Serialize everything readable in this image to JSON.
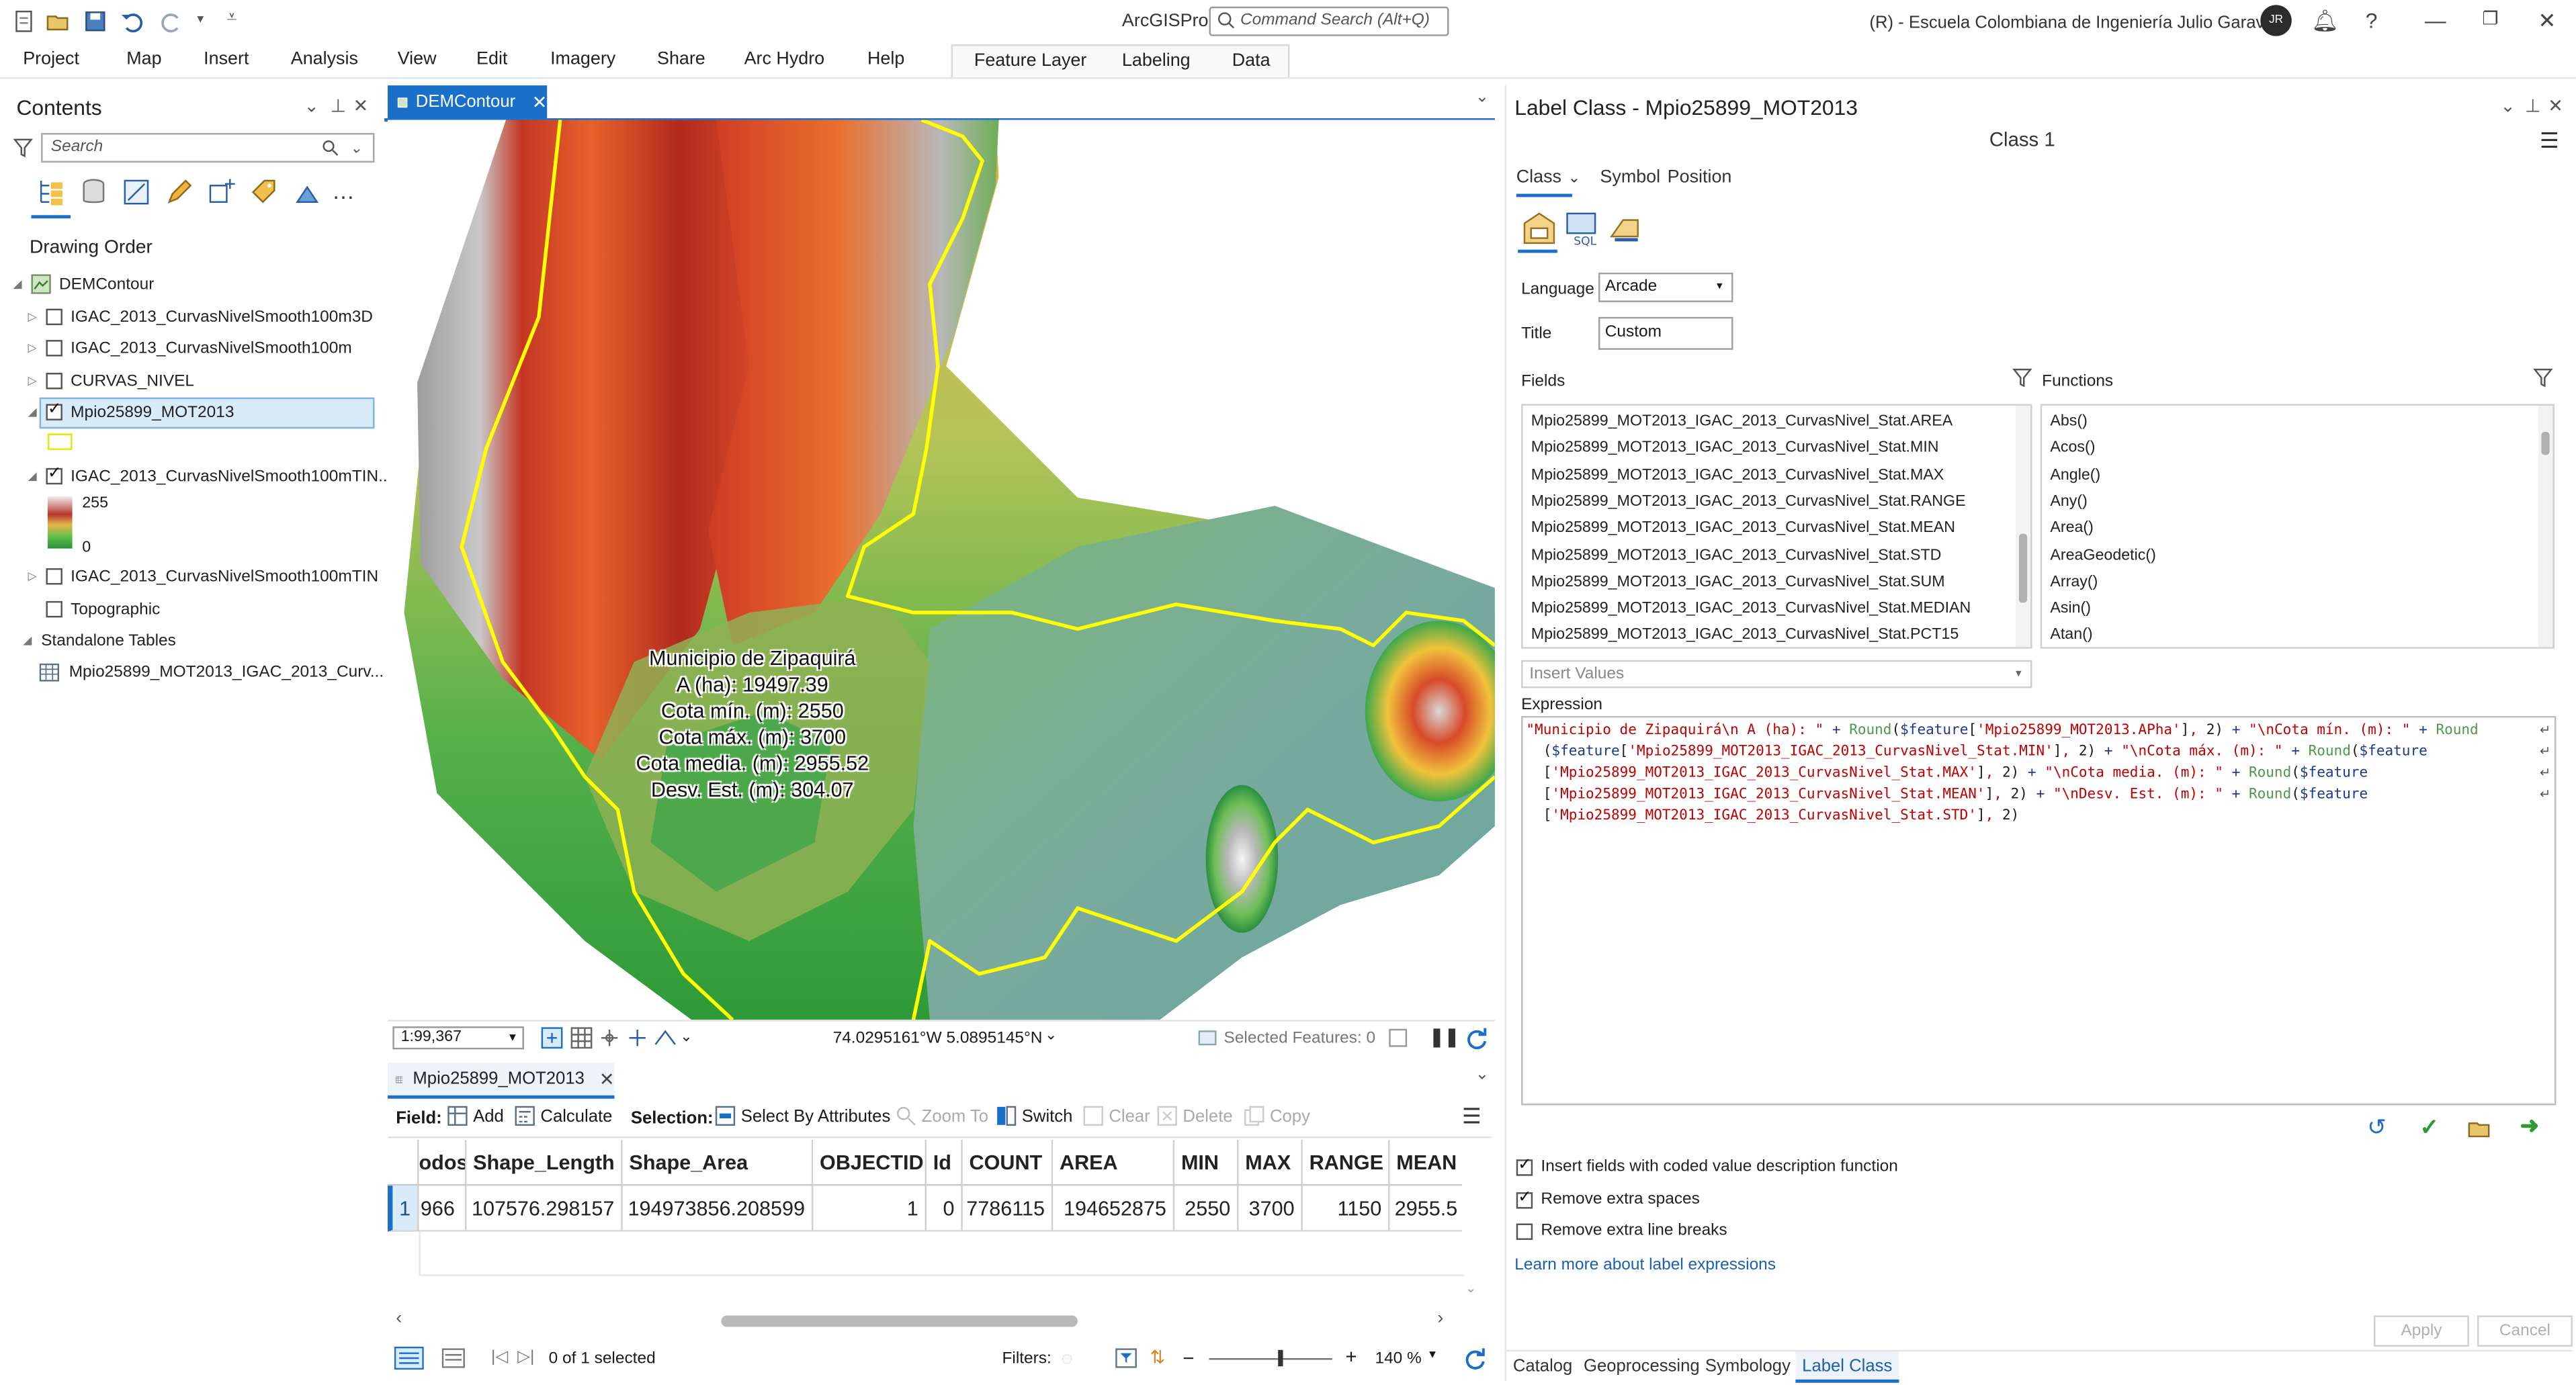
{
  "app": {
    "name": "ArcGISPro",
    "command_search_placeholder": "Command Search (Alt+Q)",
    "org": "(R) - Escuela Colombiana de Ingeniería Julio Garavito",
    "avatar_initials": "JR"
  },
  "ribbon": {
    "tabs": [
      "Project",
      "Map",
      "Insert",
      "Analysis",
      "View",
      "Edit",
      "Imagery",
      "Share",
      "Arc Hydro",
      "Help"
    ],
    "context_tabs": [
      "Feature Layer",
      "Labeling",
      "Data"
    ]
  },
  "contents": {
    "title": "Contents",
    "search_placeholder": "Search",
    "drawing_order": "Drawing Order",
    "map_name": "DEMContour",
    "layers": [
      {
        "label": "IGAC_2013_CurvasNivelSmooth100m3D",
        "checked": false
      },
      {
        "label": "IGAC_2013_CurvasNivelSmooth100m",
        "checked": false
      },
      {
        "label": "CURVAS_NIVEL",
        "checked": false
      },
      {
        "label": "Mpio25899_MOT2013",
        "checked": true
      },
      {
        "label": "IGAC_2013_CurvasNivelSmooth100mTIN...",
        "checked": true
      },
      {
        "label": "IGAC_2013_CurvasNivelSmooth100mTIN",
        "checked": false
      },
      {
        "label": "Topographic",
        "checked": false
      }
    ],
    "legend_high": "255",
    "legend_low": "0",
    "standalone_tables": "Standalone Tables",
    "table_name": "Mpio25899_MOT2013_IGAC_2013_Curv..."
  },
  "map": {
    "tab": "DEMContour",
    "label_lines": [
      "Municipio de Zipaquirá",
      "A (ha): 19497.39",
      "Cota mín. (m): 2550",
      "Cota máx. (m): 3700",
      "Cota media. (m): 2955.52",
      "Desv. Est. (m): 304.07"
    ],
    "scale": "1:99,367",
    "coordinates": "74.0295161°W 5.0895145°N",
    "selected_features": "Selected Features: 0"
  },
  "attribute_table": {
    "tab": "Mpio25899_MOT2013",
    "toolbar": {
      "field": "Field:",
      "add": "Add",
      "calculate": "Calculate",
      "selection": "Selection:",
      "select_by_attributes": "Select By Attributes",
      "zoom_to": "Zoom To",
      "switch": "Switch",
      "clear": "Clear",
      "delete": "Delete",
      "copy": "Copy"
    },
    "columns": [
      "odos",
      "Shape_Length",
      "Shape_Area",
      "OBJECTID",
      "Id",
      "COUNT",
      "AREA",
      "MIN",
      "MAX",
      "RANGE",
      "MEAN"
    ],
    "rows": [
      {
        "row_num": "1",
        "cells": [
          "966",
          "107576.298157",
          "194973856.208599",
          "1",
          "0",
          "7786115",
          "194652875",
          "2550",
          "3700",
          "1150",
          "2955.5"
        ]
      }
    ],
    "status": "0 of 1 selected",
    "filters": "Filters:",
    "zoom": "140 %"
  },
  "label_class": {
    "title": "Label Class - Mpio25899_MOT2013",
    "class_name": "Class 1",
    "tabs": [
      "Class",
      "Symbol",
      "Position"
    ],
    "language_label": "Language",
    "language_value": "Arcade",
    "title_label": "Title",
    "title_value": "Custom",
    "fields_label": "Fields",
    "functions_label": "Functions",
    "fields": [
      "Mpio25899_MOT2013_IGAC_2013_CurvasNivel_Stat.AREA",
      "Mpio25899_MOT2013_IGAC_2013_CurvasNivel_Stat.MIN",
      "Mpio25899_MOT2013_IGAC_2013_CurvasNivel_Stat.MAX",
      "Mpio25899_MOT2013_IGAC_2013_CurvasNivel_Stat.RANGE",
      "Mpio25899_MOT2013_IGAC_2013_CurvasNivel_Stat.MEAN",
      "Mpio25899_MOT2013_IGAC_2013_CurvasNivel_Stat.STD",
      "Mpio25899_MOT2013_IGAC_2013_CurvasNivel_Stat.SUM",
      "Mpio25899_MOT2013_IGAC_2013_CurvasNivel_Stat.MEDIAN",
      "Mpio25899_MOT2013_IGAC_2013_CurvasNivel_Stat.PCT15"
    ],
    "functions": [
      "Abs()",
      "Acos()",
      "Angle()",
      "Any()",
      "Area()",
      "AreaGeodetic()",
      "Array()",
      "Asin()",
      "Atan()"
    ],
    "insert_values": "Insert Values",
    "expression_label": "Expression",
    "options": [
      {
        "label": "Insert fields with coded value description function",
        "checked": true
      },
      {
        "label": "Remove extra spaces",
        "checked": true
      },
      {
        "label": "Remove extra line breaks",
        "checked": false
      }
    ],
    "learn_more": "Learn more about label expressions",
    "apply": "Apply",
    "cancel": "Cancel"
  },
  "bottom_tabs": [
    "Catalog",
    "Geoprocessing",
    "Symbology",
    "Label Class"
  ],
  "colors": {
    "accent": "#1a6fc9",
    "boundary": "#ffff00"
  }
}
